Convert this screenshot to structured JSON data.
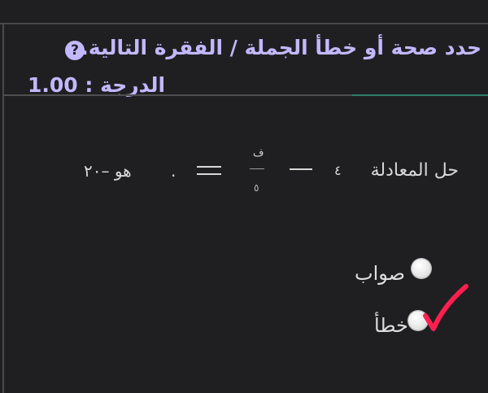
{
  "question": {
    "title": "حدد صحة أو خطأ الجملة / الفقرة التالية.",
    "help_icon": "?",
    "grade_label": "الدرجة : 1.00"
  },
  "equation": {
    "main": "حل المعادلة",
    "digit_four": "٤",
    "numerator": "ف",
    "denominator": "٥",
    "decimal_dot": ".",
    "tail": "هو –٢٠"
  },
  "options": [
    {
      "label": "صواب",
      "selected": false
    },
    {
      "label": "خطأ",
      "selected": false
    }
  ],
  "annotation": {
    "check_icon": "checkmark-icon",
    "color": "#ff1f4f"
  }
}
